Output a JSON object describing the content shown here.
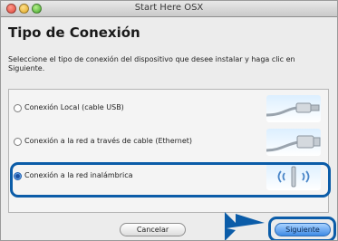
{
  "window": {
    "title": "Start Here OSX"
  },
  "page": {
    "heading": "Tipo de Conexión",
    "instructions": "Seleccione el tipo de conexión del dispositivo que desee instalar y haga clic en Siguiente."
  },
  "options": [
    {
      "label": "Conexión Local (cable USB)",
      "selected": false,
      "icon": "usb-cable-icon"
    },
    {
      "label": "Conexión a la red a través de cable (Ethernet)",
      "selected": false,
      "icon": "ethernet-cable-icon"
    },
    {
      "label": "Conexión a la red inalámbrica",
      "selected": true,
      "icon": "wireless-antenna-icon"
    }
  ],
  "buttons": {
    "cancel": "Cancelar",
    "next": "Siguiente"
  },
  "colors": {
    "highlight": "#0b5ca8",
    "next_button": "#3f8be4"
  }
}
